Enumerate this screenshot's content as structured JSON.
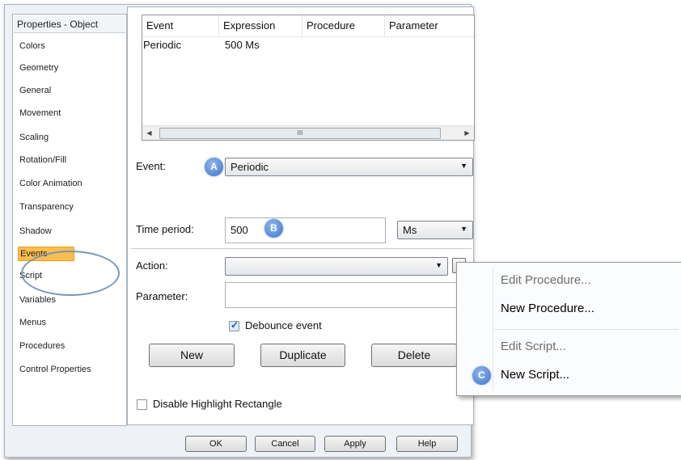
{
  "sidebar": {
    "title": "Properties - Object",
    "items": [
      "Colors",
      "Geometry",
      "General",
      "Movement",
      "Scaling",
      "Rotation/Fill",
      "Color Animation",
      "Transparency",
      "Shadow",
      "Events",
      "Script",
      "Variables",
      "Menus",
      "Procedures",
      "Control Properties"
    ],
    "selected": "Events"
  },
  "events_table": {
    "columns": [
      "Event",
      "Expression",
      "Procedure",
      "Parameter"
    ],
    "rows": [
      [
        "Periodic",
        "500 Ms",
        "",
        ""
      ]
    ],
    "scroll_thumb_glyph": "III"
  },
  "form": {
    "event_label": "Event:",
    "event_value": "Periodic",
    "time_period_label": "Time period:",
    "time_period_value": "500",
    "time_unit_value": "Ms",
    "action_label": "Action:",
    "action_value": "",
    "parameter_label": "Parameter:",
    "parameter_value": "",
    "debounce_label": "Debounce event",
    "debounce_checked": true,
    "disable_highlight_label": "Disable Highlight Rectangle",
    "disable_highlight_checked": false
  },
  "buttons": {
    "new": "New",
    "duplicate": "Duplicate",
    "delete": "Delete"
  },
  "footer": {
    "ok": "OK",
    "cancel": "Cancel",
    "apply": "Apply",
    "help": "Help"
  },
  "context_menu": {
    "items": [
      {
        "label": "Edit Procedure...",
        "enabled": false
      },
      {
        "label": "New Procedure...",
        "enabled": true
      },
      {
        "label": "Edit Script...",
        "enabled": false
      },
      {
        "label": "New Script...",
        "enabled": true
      }
    ]
  },
  "callouts": {
    "a": "A",
    "b": "B",
    "c": "C"
  },
  "colors": {
    "selection": "#fbbe4c",
    "badge": "#3f73c8",
    "ellipse": "#7b96b4"
  }
}
